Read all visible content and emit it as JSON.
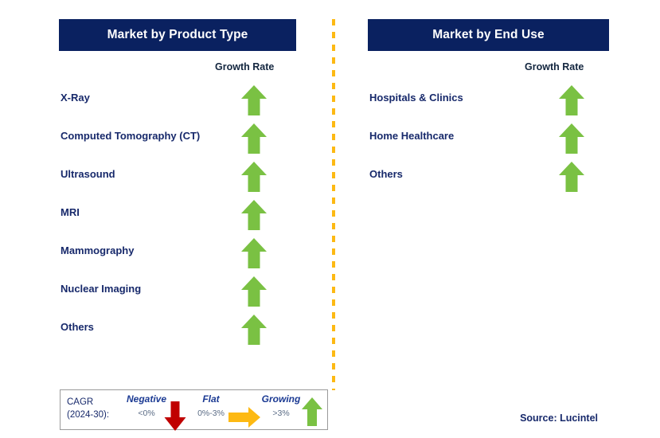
{
  "panels": [
    {
      "id": "product-type",
      "title": "Market by Product Type",
      "growth_rate_label": "Growth Rate",
      "rows": [
        {
          "label": "X-Ray",
          "growth": "up"
        },
        {
          "label": "Computed Tomography (CT)",
          "growth": "up"
        },
        {
          "label": "Ultrasound",
          "growth": "up"
        },
        {
          "label": "MRI",
          "growth": "up"
        },
        {
          "label": "Mammography",
          "growth": "up"
        },
        {
          "label": "Nuclear Imaging",
          "growth": "up"
        },
        {
          "label": "Others",
          "growth": "up"
        }
      ]
    },
    {
      "id": "end-use",
      "title": "Market by End Use",
      "growth_rate_label": "Growth Rate",
      "rows": [
        {
          "label": "Hospitals & Clinics",
          "growth": "up"
        },
        {
          "label": "Home Healthcare",
          "growth": "up"
        },
        {
          "label": "Others",
          "growth": "up"
        }
      ]
    }
  ],
  "legend": {
    "cagr_line1": "CAGR",
    "cagr_line2": "(2024-30):",
    "items": [
      {
        "title": "Negative",
        "range": "<0%",
        "icon": "down-arrow-icon",
        "color": "#c00000"
      },
      {
        "title": "Flat",
        "range": "0%-3%",
        "icon": "right-arrow-icon",
        "color": "#fdb913"
      },
      {
        "title": "Growing",
        "range": ">3%",
        "icon": "up-arrow-icon",
        "color": "#7ac143"
      }
    ]
  },
  "source": "Source: Lucintel",
  "colors": {
    "navy": "#0a2160",
    "label_blue": "#17296b",
    "green": "#7ac143",
    "red": "#c00000",
    "orange": "#fdb913",
    "divider": "#fdb913"
  }
}
